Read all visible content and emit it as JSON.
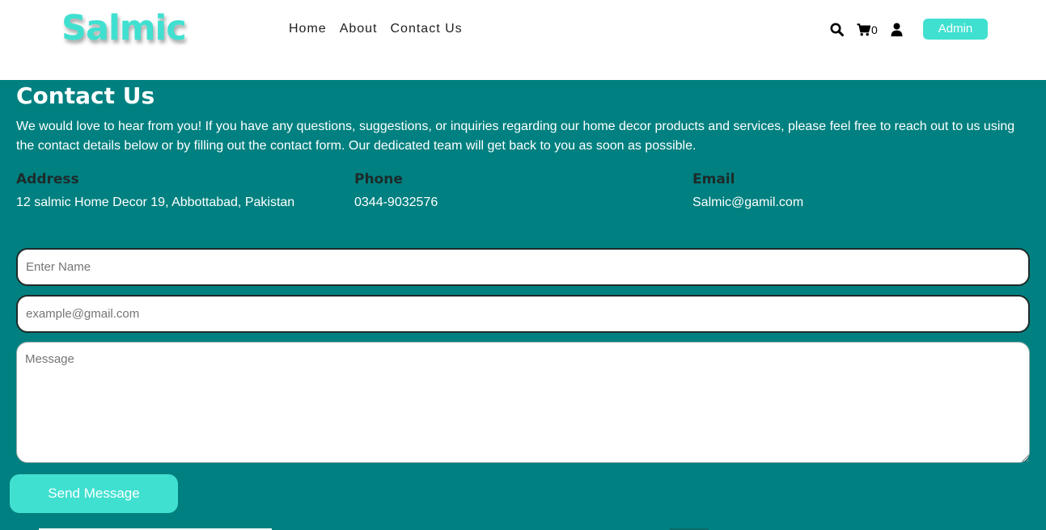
{
  "brand": {
    "logo_text": "Salmic",
    "color": "#40e0d0"
  },
  "nav": {
    "links": [
      {
        "label": "Home"
      },
      {
        "label": "About"
      },
      {
        "label": "Contact Us"
      }
    ],
    "icons": [
      "search-icon",
      "cart-icon",
      "user-icon"
    ],
    "cart_count": "0",
    "admin_label": "Admin"
  },
  "contact": {
    "title": "Contact Us",
    "intro": "We would love to hear from you! If you have any questions, suggestions, or inquiries regarding our home decor products and services, please feel free to reach out to us using the contact details below or by filling out the contact form. Our dedicated team will get back to you as soon as possible.",
    "address": {
      "label": "Address",
      "value": "12 salmic Home Decor 19, Abbottabad, Pakistan"
    },
    "phone": {
      "label": "Phone",
      "value": "0344-9032576"
    },
    "email": {
      "label": "Email",
      "value": "Salmic@gamil.com"
    },
    "background_color": "#008080"
  },
  "form": {
    "name_placeholder": "Enter Name",
    "email_placeholder": "example@gmail.com",
    "message_placeholder": "Message",
    "submit_label": "Send Message"
  }
}
